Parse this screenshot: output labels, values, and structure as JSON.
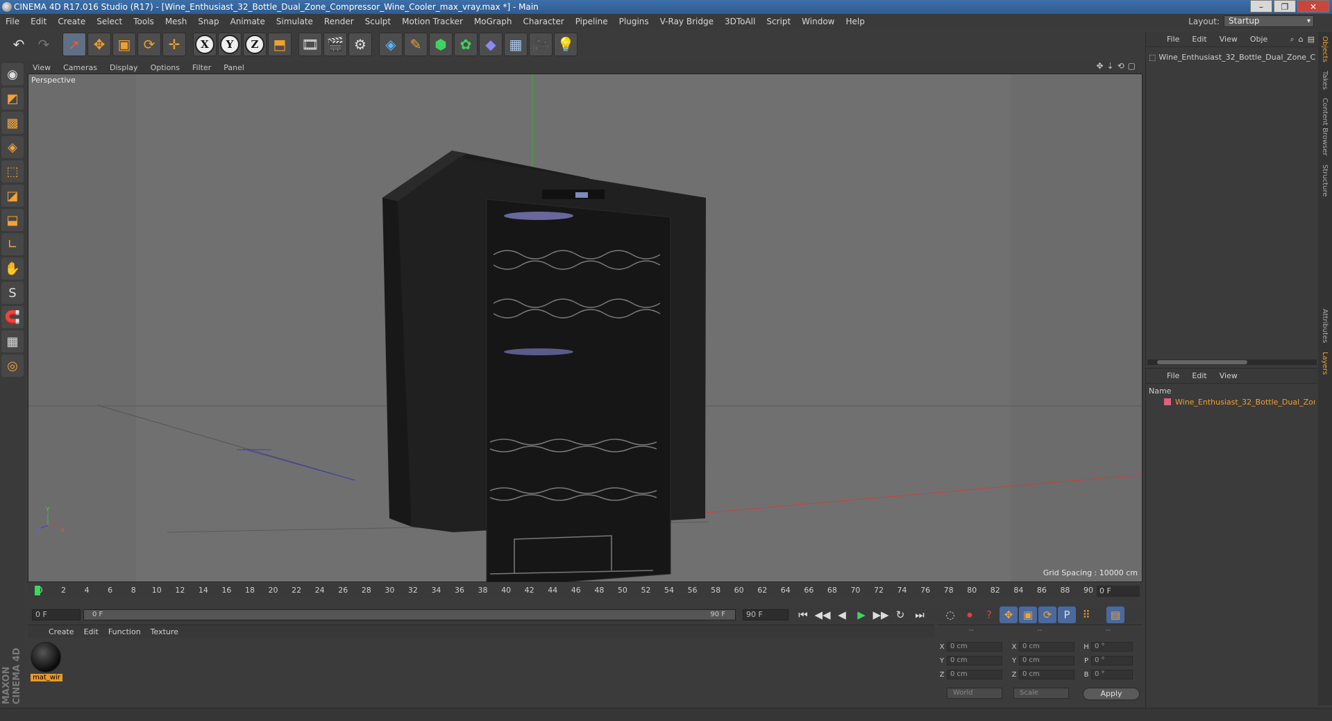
{
  "window": {
    "title": "CINEMA 4D R17.016 Studio (R17) - [Wine_Enthusiast_32_Bottle_Dual_Zone_Compressor_Wine_Cooler_max_vray.max *] - Main",
    "minimize": "–",
    "maximize": "❐",
    "close": "✕"
  },
  "menubar": [
    "File",
    "Edit",
    "Create",
    "Select",
    "Tools",
    "Mesh",
    "Snap",
    "Animate",
    "Simulate",
    "Render",
    "Sculpt",
    "Motion Tracker",
    "MoGraph",
    "Character",
    "Pipeline",
    "Plugins",
    "V-Ray Bridge",
    "3DToAll",
    "Script",
    "Window",
    "Help"
  ],
  "layout": {
    "label": "Layout:",
    "value": "Startup"
  },
  "toolbar": {
    "undo": "↶",
    "redo": "↷",
    "select": "➚",
    "move": "✥",
    "scale": "▣",
    "rotate": "⟳",
    "transform": "✛",
    "axis_x": "X",
    "axis_y": "Y",
    "axis_z": "Z",
    "coord": "⬒",
    "render_view": "🎞",
    "render": "🎬",
    "render_settings": "⚙",
    "cube": "◈",
    "pen": "✎",
    "subdiv": "⬢",
    "cloner": "✿",
    "deformer": "◆",
    "floor": "▦",
    "camera": "🎥",
    "light": "💡"
  },
  "leftbar": [
    "◉",
    "◩",
    "▩",
    "◈",
    "⬚",
    "◪",
    "⬓",
    "∟",
    "✋",
    "S",
    "🧲",
    "▦",
    "◎"
  ],
  "brand": "MAXON CINEMA 4D",
  "viewport": {
    "menu": [
      "View",
      "Cameras",
      "Display",
      "Options",
      "Filter",
      "Panel"
    ],
    "nav_icons": [
      "✥",
      "⇣",
      "⟲",
      "▢"
    ],
    "label": "Perspective",
    "grid_spacing": "Grid Spacing : 10000 cm",
    "axis_labels": {
      "y": "Y",
      "z": "Z",
      "x": "X"
    }
  },
  "timeline": {
    "ticks": [
      "0",
      "2",
      "4",
      "6",
      "8",
      "10",
      "12",
      "14",
      "16",
      "18",
      "20",
      "22",
      "24",
      "26",
      "28",
      "30",
      "32",
      "34",
      "36",
      "38",
      "40",
      "42",
      "44",
      "46",
      "48",
      "50",
      "52",
      "54",
      "56",
      "58",
      "60",
      "62",
      "64",
      "66",
      "68",
      "70",
      "72",
      "74",
      "76",
      "78",
      "80",
      "82",
      "84",
      "86",
      "88",
      "90"
    ],
    "current_frame": "0 F"
  },
  "transport": {
    "start_field": "0 F",
    "slider_left": "0 F",
    "slider_right": "90 F",
    "end_field": "90 F",
    "buttons": [
      "⏮",
      "◀◀",
      "◀",
      "▶",
      "▶▶",
      "↻",
      "⏭"
    ],
    "rec_buttons": [
      "◌",
      "⏺",
      "?",
      "✥",
      "▣",
      "⟳",
      "P",
      "⠿",
      "▤"
    ]
  },
  "material_manager": {
    "menu": [
      "Create",
      "Edit",
      "Function",
      "Texture"
    ],
    "material_name": "mat_wir"
  },
  "coordinates": {
    "header": [
      "--",
      "--",
      "--"
    ],
    "rows": [
      {
        "l1": "X",
        "v1": "0 cm",
        "l2": "X",
        "v2": "0 cm",
        "l3": "H",
        "v3": "0 °"
      },
      {
        "l1": "Y",
        "v1": "0 cm",
        "l2": "Y",
        "v2": "0 cm",
        "l3": "P",
        "v3": "0 °"
      },
      {
        "l1": "Z",
        "v1": "0 cm",
        "l2": "Z",
        "v2": "0 cm",
        "l3": "B",
        "v3": "0 °"
      }
    ],
    "mode1": "World",
    "mode2": "Scale",
    "apply": "Apply"
  },
  "object_manager": {
    "menu": [
      "File",
      "Edit",
      "View",
      "Obje"
    ],
    "object": "Wine_Enthusiast_32_Bottle_Dual_Zone_C"
  },
  "layer_manager": {
    "menu": [
      "File",
      "Edit",
      "View"
    ],
    "column": "Name",
    "layer": "Wine_Enthusiast_32_Bottle_Dual_Zone_"
  },
  "side_tabs": [
    "Objects",
    "Takes",
    "Content Browser",
    "Structure",
    "Attributes",
    "Layers"
  ]
}
